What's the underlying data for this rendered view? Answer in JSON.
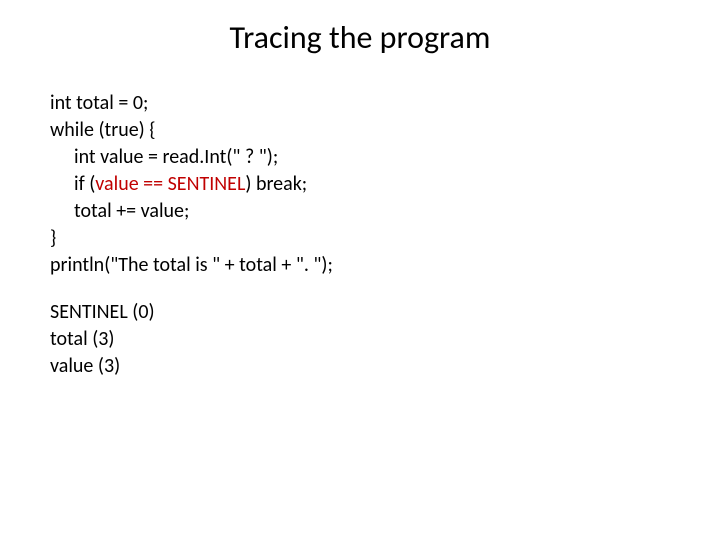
{
  "title": "Tracing the program",
  "code": {
    "l1": "int  total  =  0;",
    "l2": "while  (true) {",
    "l3a": "int  value  =  read.Int(\"  ?  \");",
    "l3b_pre": "if  (",
    "l3b_cond": "value == SENTINEL",
    "l3b_post": ")   break;",
    "l3c": "total  +=  value;",
    "l4": "}",
    "l5": "println(\"The total is \" + total + \". \");"
  },
  "trace": {
    "t1": "SENTINEL  (0)",
    "t2": "total  (3)",
    "t3": "value (3)"
  }
}
